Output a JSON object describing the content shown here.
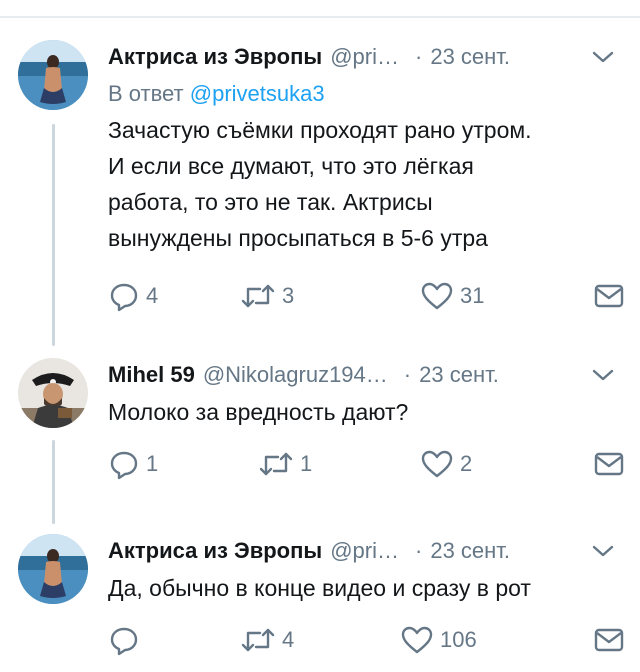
{
  "tweets": [
    {
      "author_name": "Актриса из Эвропы",
      "handle": "@pri…",
      "separator": "·",
      "time": "23 сент.",
      "reply_prefix": "В ответ",
      "reply_mention": "@privetsuka3",
      "text": "Зачастую съёмки проходят рано утром.\nИ если все думают, что это лёгкая\nработа, то это не так. Актрисы\nвынуждены просыпаться в 5-6 утра",
      "replies": "4",
      "retweets": "3",
      "likes": "31"
    },
    {
      "author_name": "Mihel 59",
      "handle": "@Nikolagruz194…",
      "separator": "·",
      "time": "23 сент.",
      "text": "Молоко за вредность дают?",
      "replies": "1",
      "retweets": "1",
      "likes": "2"
    },
    {
      "author_name": "Актриса из Эвропы",
      "handle": "@pri…",
      "separator": "·",
      "time": "23 сент.",
      "text": "Да, обычно в конце видео и сразу в рот",
      "replies": "",
      "retweets": "4",
      "likes": "106"
    }
  ],
  "colors": {
    "text": "#14171a",
    "secondary": "#657786",
    "link": "#1da1f2",
    "thread_line": "#ccd6dd"
  }
}
